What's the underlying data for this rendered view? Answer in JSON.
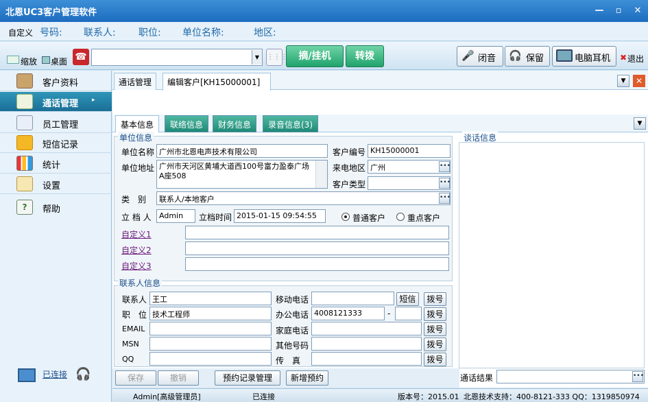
{
  "app": {
    "title": "北恩UC3客户管理软件"
  },
  "info": {
    "custom": "自定义",
    "phone": "号码:",
    "contact": "联系人:",
    "position": "职位:",
    "company": "单位名称:",
    "region": "地区:"
  },
  "toolbar": {
    "shrink": "缩放",
    "desktop": "桌面",
    "dial": "摘/挂机",
    "transfer": "转拨",
    "mute": "闭音",
    "hold": "保留",
    "headset": "电脑耳机",
    "exit": "退出"
  },
  "sidebar": {
    "items": [
      {
        "label": "客户资料",
        "icon": "customer-icon"
      },
      {
        "label": "通话管理",
        "icon": "call-icon"
      },
      {
        "label": "员工管理",
        "icon": "staff-icon"
      },
      {
        "label": "短信记录",
        "icon": "sms-icon"
      },
      {
        "label": "统计",
        "icon": "chart-icon"
      },
      {
        "label": "设置",
        "icon": "settings-icon"
      },
      {
        "label": "帮助",
        "icon": "help-icon"
      }
    ],
    "connected": "已连接"
  },
  "tabs": {
    "top": [
      "通话管理",
      "编辑客户[KH15000001]"
    ],
    "sub": [
      "基本信息",
      "联络信息",
      "财务信息",
      "录音信息(3)"
    ]
  },
  "unit": {
    "group": "单位信息",
    "name_label": "单位名称",
    "name": "广州市北恩电声技术有限公司",
    "code_label": "客户编号",
    "code": "KH15000001",
    "addr_label": "单位地址",
    "addr": "广州市天河区黄埔大道西100号富力盈泰广场A座508",
    "region_label": "来电地区",
    "region": "广州",
    "type_label": "客户类型",
    "type": "",
    "cat_label": "类　别",
    "cat": "联系人/本地客户",
    "creator_label": "立 档 人",
    "creator": "Admin",
    "time_label": "立档时间",
    "time": "2015-01-15 09:54:55",
    "radio1": "普通客户",
    "radio2": "重点客户",
    "custom1": "自定义1",
    "custom2": "自定义2",
    "custom3": "自定义3"
  },
  "contact": {
    "group": "联系人信息",
    "name_label": "联系人",
    "name": "王工",
    "pos_label": "职　位",
    "pos": "技术工程师",
    "email_label": "EMAIL",
    "msn_label": "MSN",
    "qq_label": "QQ",
    "mobile_label": "移动电话",
    "office_label": "办公电话",
    "office": "4008121333",
    "dash": "-",
    "home_label": "家庭电话",
    "other_label": "其他号码",
    "fax_label": "传　真",
    "sms": "短信",
    "dial": "拨号"
  },
  "buttons": {
    "save": "保存",
    "cancel": "撤销",
    "appt": "预约记录管理",
    "new_appt": "新增预约"
  },
  "talk": {
    "title": "谈话信息",
    "result_label": "通话结果"
  },
  "status": {
    "user": "Admin[高级管理员]",
    "conn": "已连接",
    "version": "版本号：2015.01",
    "support": "北恩技术支持：400-8121-333 QQ：1319850974"
  }
}
